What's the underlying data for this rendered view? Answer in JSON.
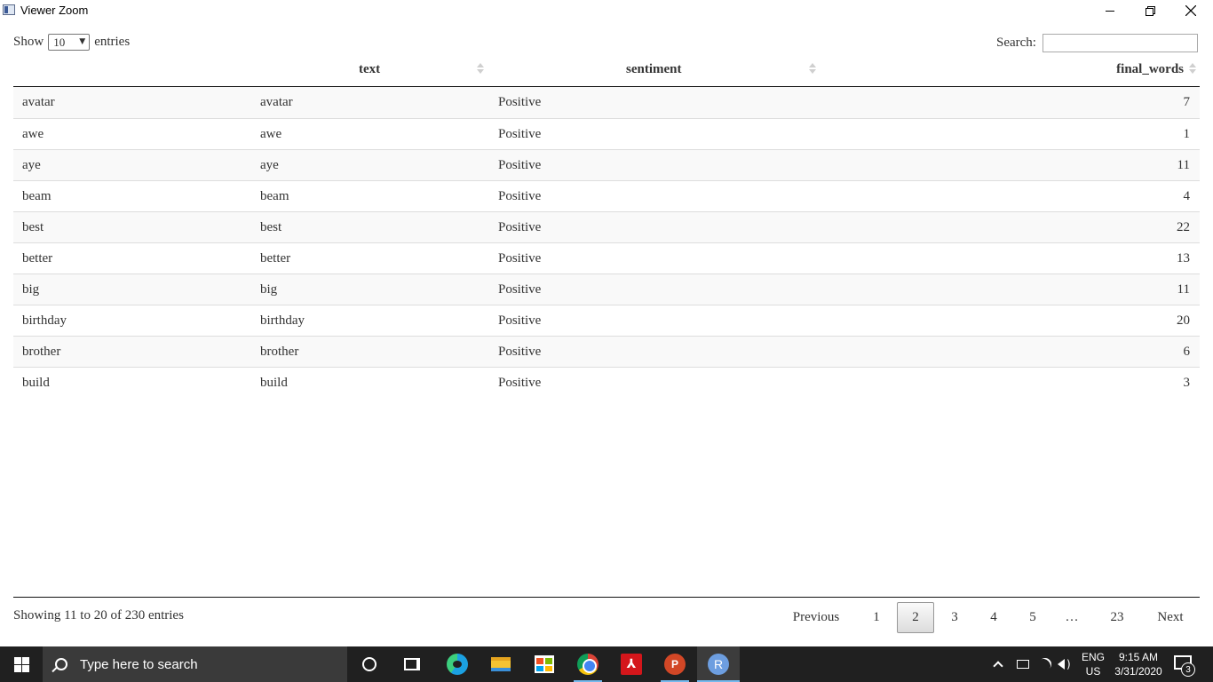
{
  "window": {
    "title": "Viewer Zoom"
  },
  "controls": {
    "show_label": "Show",
    "entries_value": "10",
    "entries_label": "entries",
    "search_label": "Search:",
    "search_value": ""
  },
  "table": {
    "columns": [
      "",
      "text",
      "sentiment",
      "final_words"
    ],
    "rows": [
      [
        "avatar",
        "avatar",
        "Positive",
        "7"
      ],
      [
        "awe",
        "awe",
        "Positive",
        "1"
      ],
      [
        "aye",
        "aye",
        "Positive",
        "11"
      ],
      [
        "beam",
        "beam",
        "Positive",
        "4"
      ],
      [
        "best",
        "best",
        "Positive",
        "22"
      ],
      [
        "better",
        "better",
        "Positive",
        "13"
      ],
      [
        "big",
        "big",
        "Positive",
        "11"
      ],
      [
        "birthday",
        "birthday",
        "Positive",
        "20"
      ],
      [
        "brother",
        "brother",
        "Positive",
        "6"
      ],
      [
        "build",
        "build",
        "Positive",
        "3"
      ]
    ]
  },
  "footer": {
    "info": "Showing 11 to 20 of 230 entries",
    "pagination": {
      "previous": "Previous",
      "pages": [
        "1",
        "2",
        "3",
        "4",
        "5",
        "…",
        "23"
      ],
      "current": "2",
      "next": "Next"
    }
  },
  "taskbar": {
    "search_placeholder": "Type here to search",
    "apps": [
      "cortana-icon",
      "task-view-icon",
      "edge-icon",
      "file-explorer-icon",
      "store-icon",
      "chrome-icon",
      "acrobat-icon",
      "powerpoint-icon",
      "r-icon"
    ],
    "powerpoint_glyph": "P",
    "r_glyph": "R",
    "language": "ENG",
    "region": "US",
    "time": "9:15 AM",
    "date": "3/31/2020",
    "notification_count": "3"
  }
}
